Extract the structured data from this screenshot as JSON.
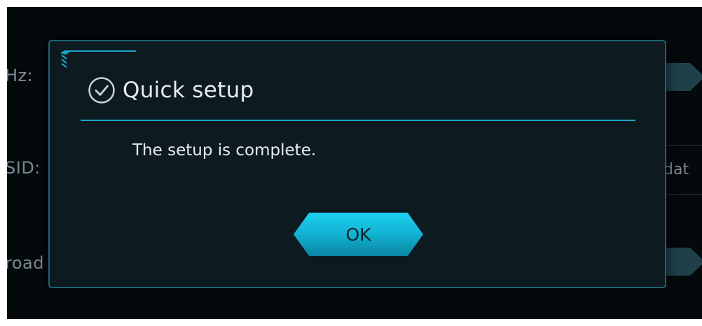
{
  "background": {
    "labels": [
      "Hz:",
      "SID:",
      "road"
    ],
    "right_field_text": "dat"
  },
  "dialog": {
    "title": "Quick setup",
    "title_icon": "check-circle-icon",
    "message": "The setup is complete.",
    "ok_label": "OK"
  },
  "colors": {
    "accent": "#1aa8c8",
    "button_top": "#1ed0ef",
    "button_bottom": "#0a86a3",
    "dialog_bg": "#0d1a20",
    "screen_bg": "#04090c"
  }
}
